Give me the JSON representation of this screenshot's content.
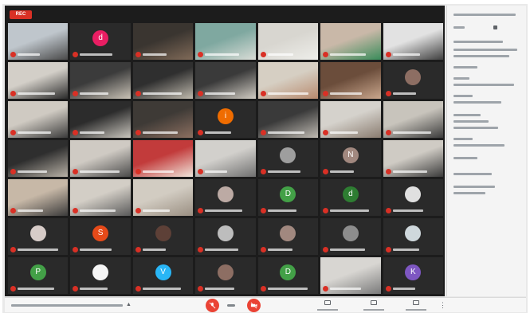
{
  "recording": {
    "label": "REC",
    "color": "#d93025"
  },
  "colors": {
    "mute_red": "#d93025",
    "control_red": "#ea4335",
    "meet_bg": "#1c1c1c",
    "panel_bg": "#f4f4f4"
  },
  "grid": {
    "columns": 7,
    "rows": 7
  },
  "tiles": [
    {
      "kind": "video",
      "c1": "#bfc6cc",
      "c2": "#4a4a4a"
    },
    {
      "kind": "avatar",
      "letter": "d",
      "color": "#e91e63"
    },
    {
      "kind": "video",
      "c1": "#3a3530",
      "c2": "#806a58"
    },
    {
      "kind": "video",
      "c1": "#7fa8a0",
      "c2": "#d9dcd6"
    },
    {
      "kind": "video",
      "c1": "#d8d6d0",
      "c2": "#eeeeea"
    },
    {
      "kind": "video",
      "c1": "#c9b8a8",
      "c2": "#3a8c5a"
    },
    {
      "kind": "video",
      "c1": "#e2e2e2",
      "c2": "#3f3f3f"
    },
    {
      "kind": "video",
      "c1": "#d3cfc8",
      "c2": "#2b2b2b"
    },
    {
      "kind": "video",
      "c1": "#3b3b3b",
      "c2": "#c9c2b6"
    },
    {
      "kind": "video",
      "c1": "#2f2f2f",
      "c2": "#bfb9ad"
    },
    {
      "kind": "video",
      "c1": "#3a3a3a",
      "c2": "#d0cbc2"
    },
    {
      "kind": "video",
      "c1": "#d6cfc3",
      "c2": "#b88a6e"
    },
    {
      "kind": "video",
      "c1": "#6b4d3b",
      "c2": "#c9a68c"
    },
    {
      "kind": "avatar",
      "letter": "",
      "color": "#8d6e63"
    },
    {
      "kind": "video",
      "c1": "#cfcac2",
      "c2": "#3b3b3b"
    },
    {
      "kind": "video",
      "c1": "#2c2c2c",
      "c2": "#c9c5bd"
    },
    {
      "kind": "video",
      "c1": "#3e3a36",
      "c2": "#8c6f60"
    },
    {
      "kind": "avatar",
      "letter": "i",
      "color": "#ef6c00"
    },
    {
      "kind": "video",
      "c1": "#3a3a3a",
      "c2": "#bfbab2"
    },
    {
      "kind": "video",
      "c1": "#d5d2cc",
      "c2": "#8a7c70"
    },
    {
      "kind": "video",
      "c1": "#c8c4bc",
      "c2": "#3c3c3c"
    },
    {
      "kind": "video",
      "c1": "#2e2e2e",
      "c2": "#b8b1a6"
    },
    {
      "kind": "video",
      "c1": "#cfcac3",
      "c2": "#4a4a4a"
    },
    {
      "kind": "video",
      "c1": "#c23b3b",
      "c2": "#f0e6dc"
    },
    {
      "kind": "video",
      "c1": "#d2d0cc",
      "c2": "#707070"
    },
    {
      "kind": "avatar",
      "letter": "",
      "color": "#9e9e9e"
    },
    {
      "kind": "avatar",
      "letter": "N",
      "color": "#a1887f"
    },
    {
      "kind": "video",
      "c1": "#cfcbc4",
      "c2": "#3a3a3a"
    },
    {
      "kind": "video",
      "c1": "#c7b8a7",
      "c2": "#3b3b3b"
    },
    {
      "kind": "video",
      "c1": "#d3cec6",
      "c2": "#5a5a5a"
    },
    {
      "kind": "video",
      "c1": "#d2ccc2",
      "c2": "#9a8f82"
    },
    {
      "kind": "avatar",
      "letter": "",
      "color": "#bcaaa4"
    },
    {
      "kind": "avatar",
      "letter": "D",
      "color": "#43a047"
    },
    {
      "kind": "avatar",
      "letter": "d",
      "color": "#2e7d32"
    },
    {
      "kind": "avatar",
      "letter": "",
      "color": "#e0e0e0"
    },
    {
      "kind": "avatar",
      "letter": "",
      "color": "#d7ccc8"
    },
    {
      "kind": "avatar",
      "letter": "S",
      "color": "#e64a19"
    },
    {
      "kind": "avatar",
      "letter": "",
      "color": "#5d4037"
    },
    {
      "kind": "avatar",
      "letter": "",
      "color": "#bdbdbd"
    },
    {
      "kind": "avatar",
      "letter": "",
      "color": "#a1887f"
    },
    {
      "kind": "avatar",
      "letter": "",
      "color": "#8d8d8d"
    },
    {
      "kind": "avatar",
      "letter": "",
      "color": "#cfd8dc"
    },
    {
      "kind": "avatar",
      "letter": "P",
      "color": "#43a047"
    },
    {
      "kind": "avatar",
      "letter": "",
      "color": "#f5f5f5"
    },
    {
      "kind": "avatar",
      "letter": "V",
      "color": "#29b6f6"
    },
    {
      "kind": "avatar",
      "letter": "",
      "color": "#8d6e63"
    },
    {
      "kind": "avatar",
      "letter": "D",
      "color": "#43a047"
    },
    {
      "kind": "video",
      "c1": "#d8d6d2",
      "c2": "#7a7a7a"
    },
    {
      "kind": "avatar",
      "letter": "K",
      "color": "#7e57c2"
    }
  ],
  "controls": {
    "mic_icon": "mic-off-icon",
    "camera_icon": "camera-off-icon",
    "hangup_icon": "call-end-icon",
    "more_icon": "more-vert-icon",
    "chevron_icon": "chevron-up-icon"
  }
}
